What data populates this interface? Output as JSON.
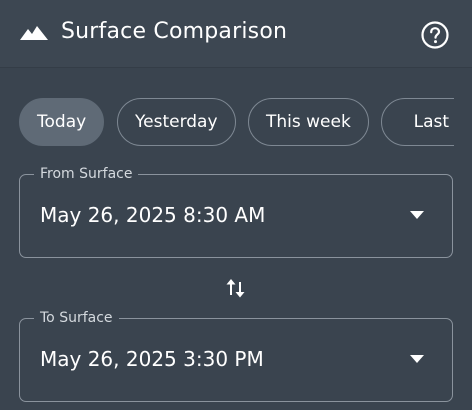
{
  "header": {
    "title": "Surface Comparison",
    "logo_icon": "mountain-icon",
    "help_icon": "help-circle-icon"
  },
  "chips": [
    {
      "label": "Today",
      "selected": true
    },
    {
      "label": "Yesterday",
      "selected": false
    },
    {
      "label": "This week",
      "selected": false
    },
    {
      "label": "Last w",
      "selected": false
    }
  ],
  "from_field": {
    "label": "From Surface",
    "value": "May 26, 2025 8:30 AM",
    "icon": "caret-down-icon"
  },
  "swap": {
    "icon": "swap-vertical-icon"
  },
  "to_field": {
    "label": "To Surface",
    "value": "May 26, 2025 3:30 PM",
    "icon": "caret-down-icon"
  },
  "colors": {
    "background": "#3a444f",
    "header": "#3d4752",
    "chip_selected": "#5f6a76",
    "border": "#8a939d",
    "text": "#ffffff"
  }
}
